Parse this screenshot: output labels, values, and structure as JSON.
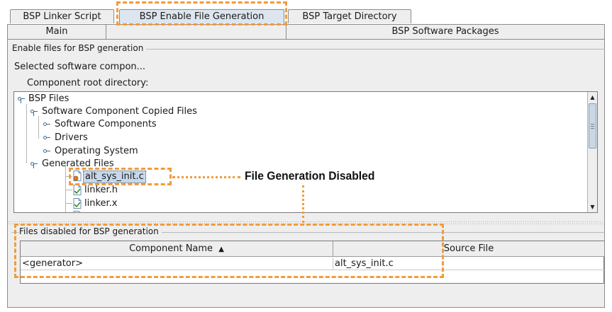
{
  "tabs_row1": [
    {
      "label": "BSP Linker Script",
      "selected": false
    },
    {
      "label": "BSP Enable File Generation",
      "selected": true
    },
    {
      "label": "BSP Target Directory",
      "selected": false
    }
  ],
  "tabs_row2": [
    {
      "label": "Main"
    },
    {
      "label": ""
    },
    {
      "label": "BSP Software Packages"
    }
  ],
  "panel": {
    "group_title": "Enable files for BSP generation",
    "selected_component": "Selected software compon...",
    "component_root": "Component root directory:"
  },
  "tree": {
    "nodes": [
      {
        "label": "BSP Files",
        "type": "expanded"
      },
      {
        "label": "Software Component Copied Files",
        "type": "expanded"
      },
      {
        "label": "Software Components",
        "type": "collapsed"
      },
      {
        "label": "Drivers",
        "type": "collapsed"
      },
      {
        "label": "Operating System",
        "type": "collapsed"
      },
      {
        "label": "Generated Files",
        "type": "expanded"
      },
      {
        "label": "alt_sys_init.c",
        "type": "file-disabled",
        "selected": true
      },
      {
        "label": "linker.h",
        "type": "file"
      },
      {
        "label": "linker.x",
        "type": "file"
      }
    ]
  },
  "disabled_group": {
    "title": "Files disabled for BSP generation",
    "columns": [
      "Component Name",
      "Source File"
    ],
    "sort_indicator": "▲",
    "rows": [
      [
        "<generator>",
        "alt_sys_init.c"
      ]
    ]
  },
  "annotation": {
    "label": "File Generation Disabled",
    "color": "#f29b3a"
  },
  "colors": {
    "accent": "#f29b3a",
    "selection": "#c7d8ea",
    "icon_blue": "#3f6c93"
  }
}
